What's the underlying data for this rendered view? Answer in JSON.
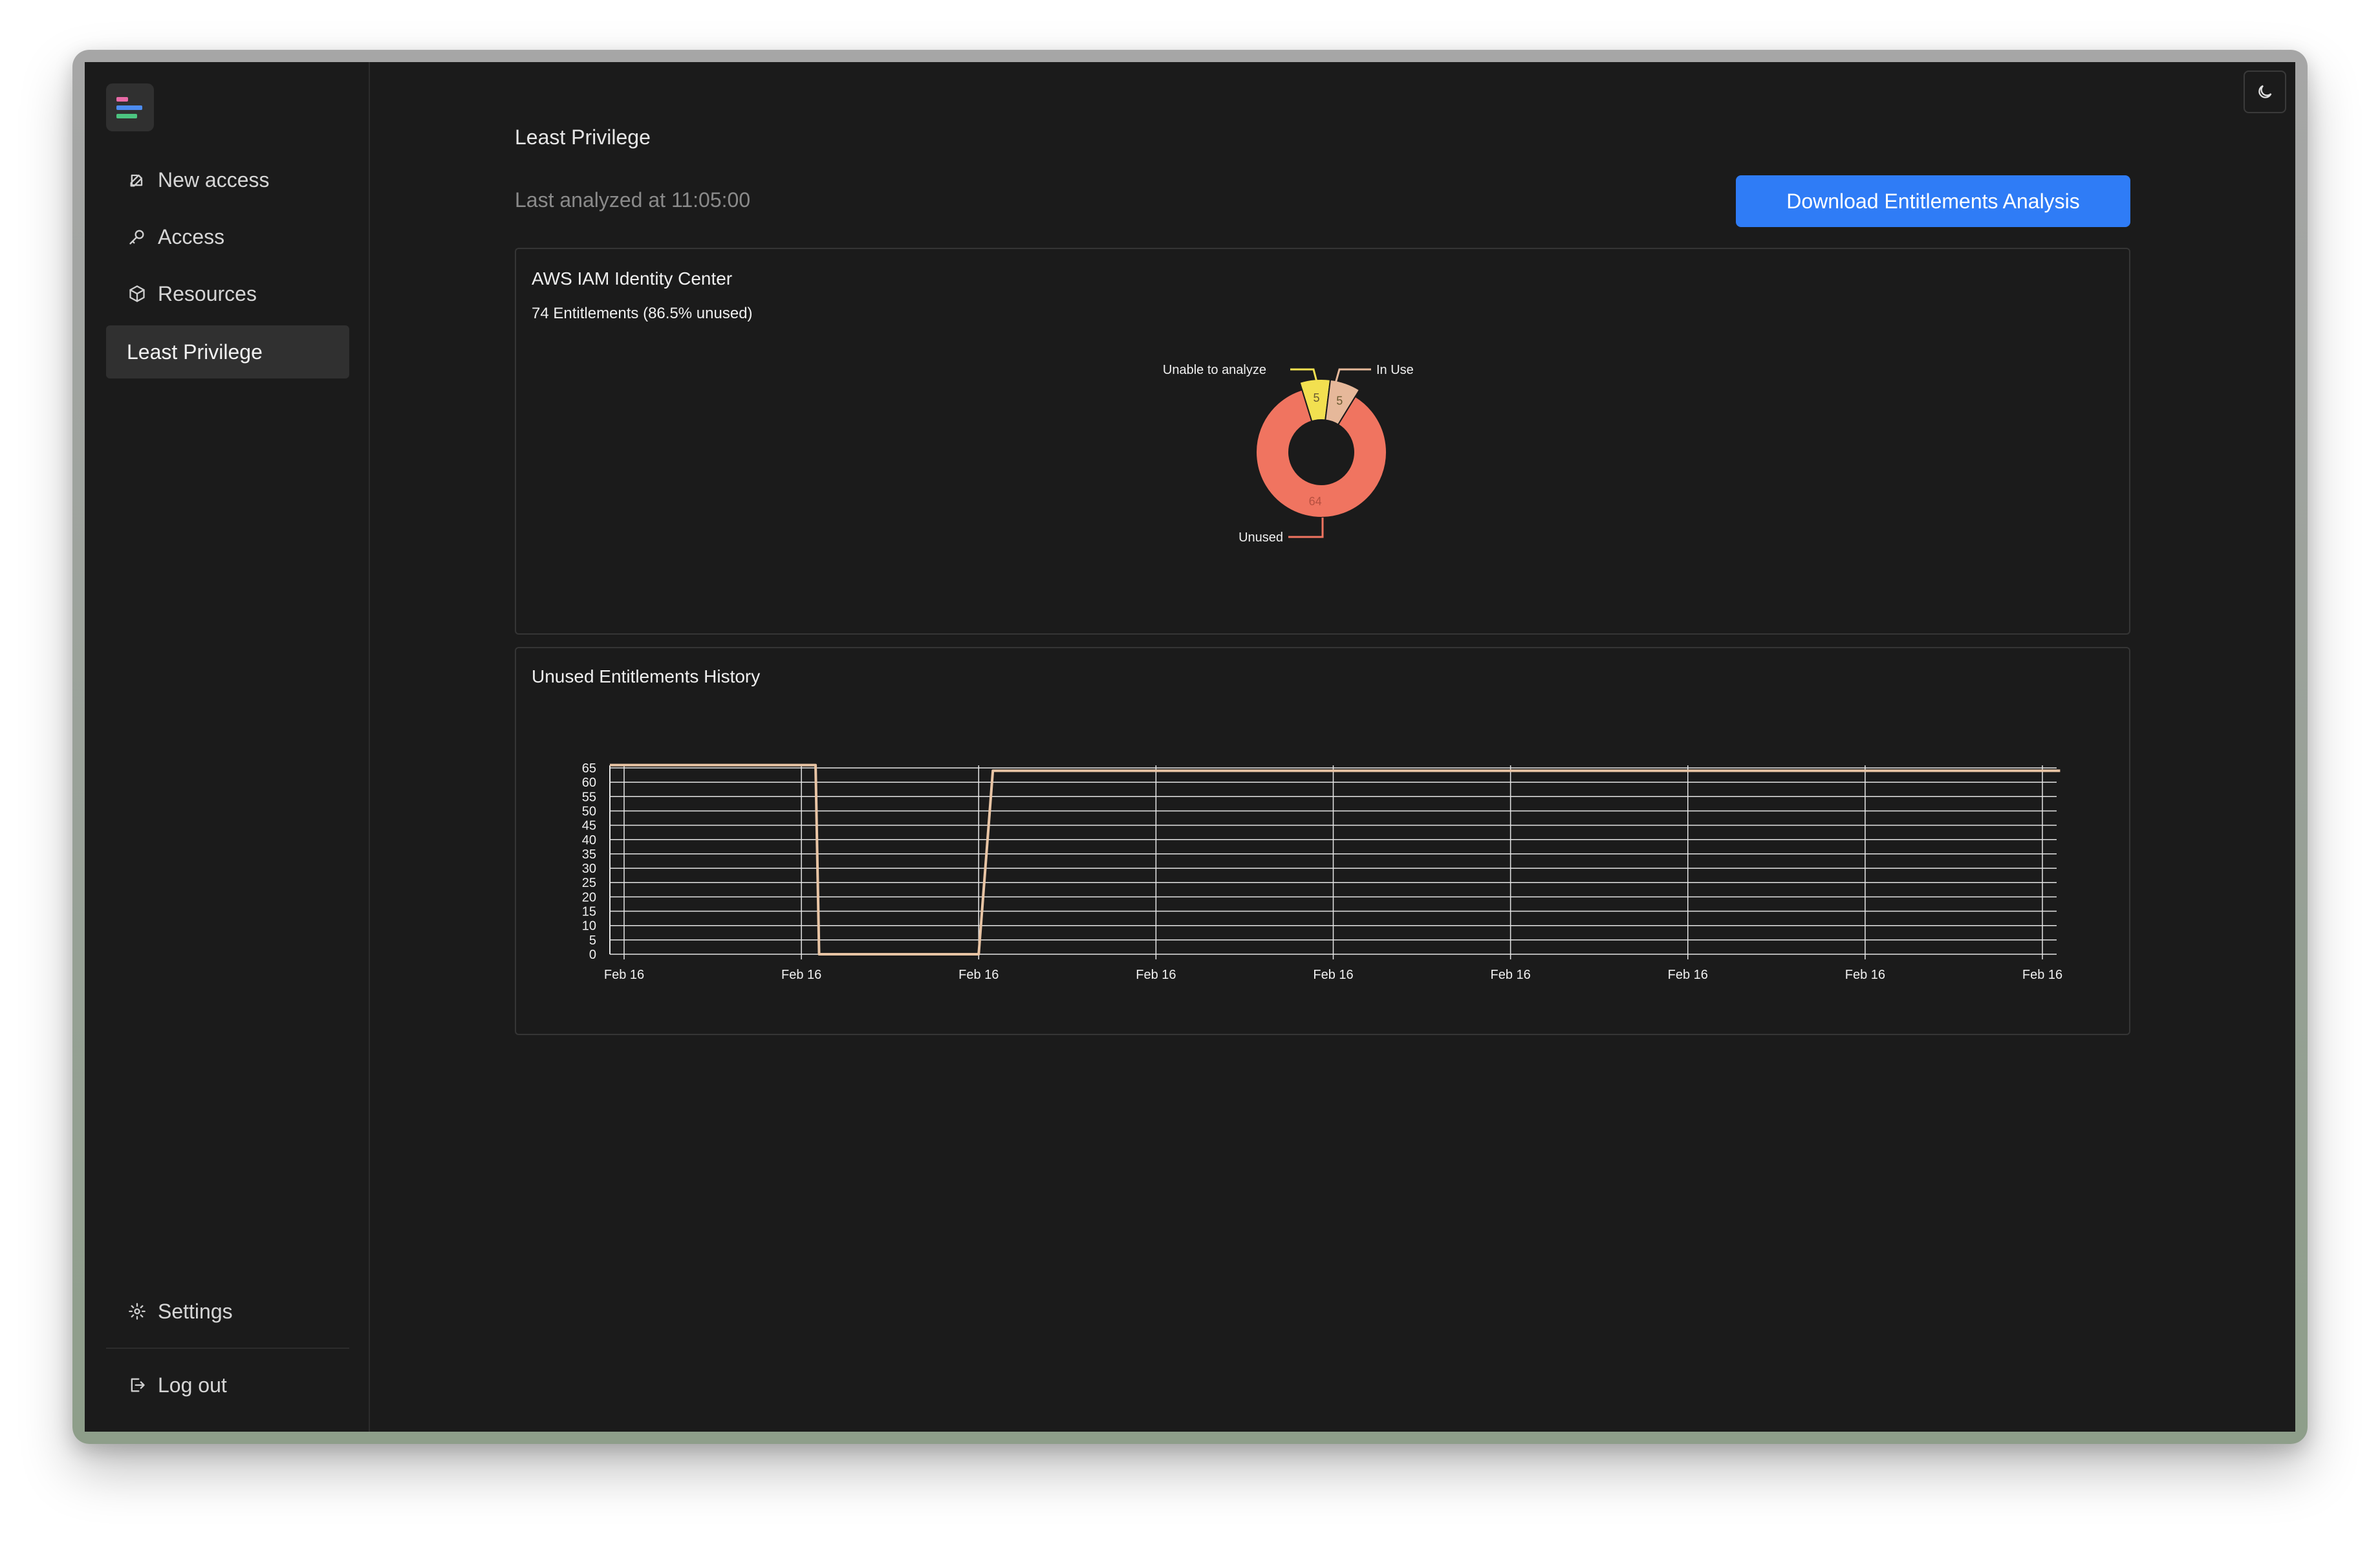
{
  "sidebar": {
    "items": [
      {
        "label": "New access",
        "icon": "edit-icon"
      },
      {
        "label": "Access",
        "icon": "key-icon"
      },
      {
        "label": "Resources",
        "icon": "cube-icon"
      },
      {
        "label": "Least Privilege",
        "active": true
      }
    ],
    "settings_label": "Settings",
    "logout_label": "Log out"
  },
  "header": {
    "title": "Least Privilege",
    "last_analyzed": "Last analyzed at 11:05:00",
    "download_label": "Download Entitlements Analysis"
  },
  "colors": {
    "unused": "#f07460",
    "in_use": "#e6b89a",
    "unable": "#f2e050",
    "accent": "#2f7cf6",
    "line": "#e8c4a4"
  },
  "identity_card": {
    "title": "AWS IAM Identity Center",
    "subtitle": "74 Entitlements (86.5% unused)"
  },
  "history_card": {
    "title": "Unused Entitlements History"
  },
  "chart_data": [
    {
      "type": "pie",
      "labels": [
        "Unable to analyze",
        "In Use",
        "Unused"
      ],
      "values": [
        5,
        5,
        64
      ]
    },
    {
      "type": "line",
      "title": "Unused Entitlements History",
      "x_tick_labels": [
        "Feb 16",
        "Feb 16",
        "Feb 16",
        "Feb 16",
        "Feb 16",
        "Feb 16",
        "Feb 16",
        "Feb 16",
        "Feb 16"
      ],
      "y_ticks": [
        0,
        5,
        10,
        15,
        20,
        25,
        30,
        35,
        40,
        45,
        50,
        55,
        60,
        65
      ],
      "ylim": [
        0,
        65
      ],
      "x": [
        0,
        1.08,
        1.1,
        2.0,
        2.08,
        8.1
      ],
      "values": [
        66,
        66,
        0,
        0,
        64,
        64
      ],
      "grid": true
    }
  ]
}
